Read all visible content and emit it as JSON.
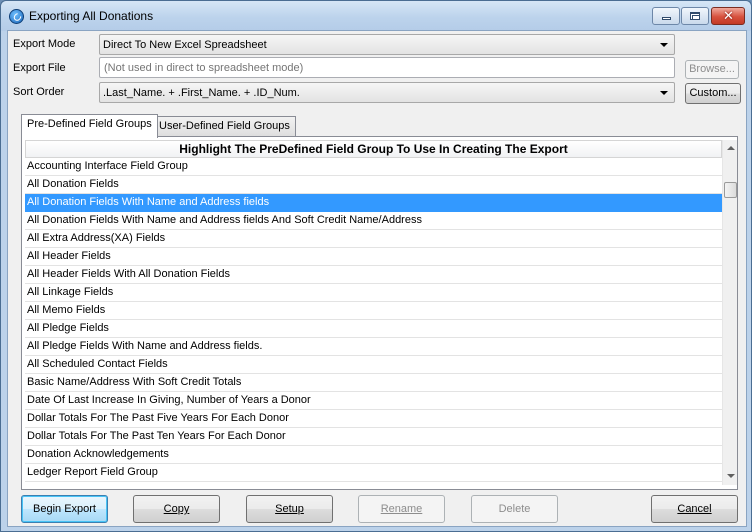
{
  "window": {
    "title": "Exporting All Donations"
  },
  "form": {
    "export_mode_label": "Export Mode",
    "export_mode_value": "Direct To New Excel Spreadsheet",
    "export_file_label": "Export File",
    "export_file_placeholder": "(Not used in direct to spreadsheet mode)",
    "browse_label": "Browse...",
    "sort_order_label": "Sort Order",
    "sort_order_value": ".Last_Name. + .First_Name. + .ID_Num.",
    "custom_label": "Custom..."
  },
  "tabs": [
    {
      "label": "Pre-Defined Field Groups",
      "active": true
    },
    {
      "label": "User-Defined Field Groups",
      "active": false
    }
  ],
  "list": {
    "header": "Highlight The PreDefined Field Group To Use In Creating The Export",
    "selected_index": 2,
    "items": [
      "Accounting Interface Field Group",
      "All Donation Fields",
      "All Donation Fields With Name and Address fields",
      "All Donation Fields With Name and Address fields And Soft Credit Name/Address",
      "All Extra Address(XA) Fields",
      "All Header Fields",
      "All Header Fields With All Donation Fields",
      "All Linkage Fields",
      "All Memo Fields",
      "All Pledge Fields",
      "All Pledge Fields With Name and Address fields.",
      "All Scheduled Contact Fields",
      "Basic Name/Address With Soft Credit Totals",
      "Date Of Last Increase In Giving, Number of Years a Donor",
      "Dollar Totals For The Past Five Years For Each Donor",
      "Dollar Totals For The Past Ten Years For Each Donor",
      "Donation Acknowledgements",
      "Ledger Report Field Group"
    ]
  },
  "buttons": {
    "begin_export": "Begin Export",
    "copy": "Copy",
    "setup": "Setup",
    "rename": "Rename",
    "delete": "Delete",
    "cancel": "Cancel"
  },
  "colors": {
    "selection": "#3399ff",
    "titlebar": "#bcd3ec",
    "close_button": "#d7513e"
  }
}
